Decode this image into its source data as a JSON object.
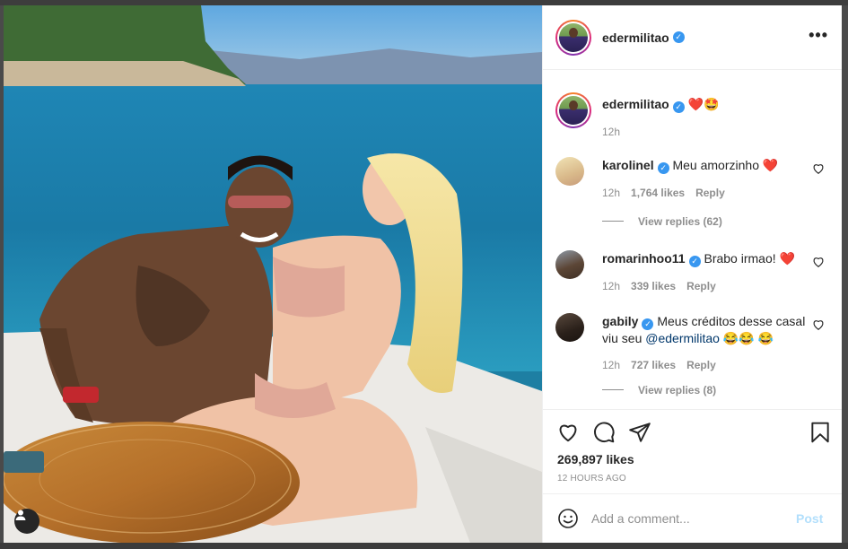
{
  "post": {
    "username": "edermilitao",
    "more_label": "•••",
    "caption_emojis": "❤️🤩",
    "caption_time": "12h"
  },
  "comments": [
    {
      "user": "karolinel",
      "text": "Meu amorzinho ❤️",
      "time": "12h",
      "likes": "1,764 likes",
      "reply": "Reply",
      "view_replies": "View replies (62)"
    },
    {
      "user": "romarinhoo11",
      "text": "Brabo irmao! ❤️",
      "time": "12h",
      "likes": "339 likes",
      "reply": "Reply"
    },
    {
      "user": "gabily",
      "text_before": "Meus créditos desse casal viu seu ",
      "mention": "@edermilitao",
      "text_after": " 😂😂 😂",
      "time": "12h",
      "likes": "727 likes",
      "reply": "Reply",
      "view_replies": "View replies (8)"
    }
  ],
  "actions": {
    "likes": "269,897 likes",
    "timestamp": "12 HOURS AGO"
  },
  "add_comment": {
    "placeholder": "Add a comment...",
    "post_label": "Post"
  },
  "icons": [
    "heart-icon",
    "comment-icon",
    "share-icon",
    "bookmark-icon",
    "emoji-icon",
    "user-tag-icon",
    "verified-icon",
    "more-icon"
  ],
  "colors": {
    "verified": "#3897f0",
    "post_disabled": "#b2dffc",
    "link": "#00376b",
    "meta": "#8e8e8e"
  }
}
